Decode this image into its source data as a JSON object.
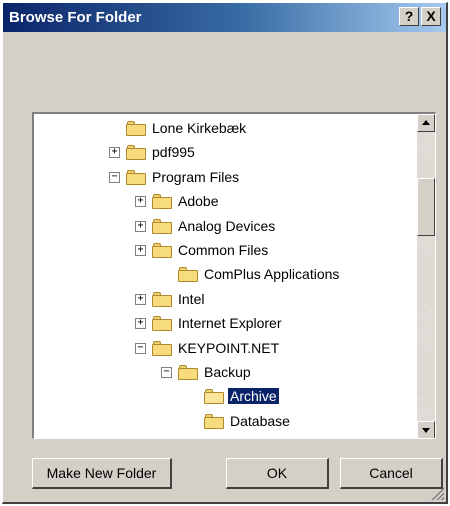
{
  "window": {
    "title": "Browse For Folder",
    "help_label": "?",
    "close_label": "X"
  },
  "tree": {
    "items": [
      {
        "label": "Lone Kirkebæk",
        "expander": "",
        "level": 2
      },
      {
        "label": "pdf995",
        "expander": "+",
        "level": 1
      },
      {
        "label": "Program Files",
        "expander": "−",
        "level": 1
      },
      {
        "label": "Adobe",
        "expander": "+",
        "level": 2
      },
      {
        "label": "Analog Devices",
        "expander": "+",
        "level": 2
      },
      {
        "label": "Common Files",
        "expander": "+",
        "level": 2
      },
      {
        "label": "ComPlus Applications",
        "expander": "",
        "level": 3
      },
      {
        "label": "Intel",
        "expander": "+",
        "level": 2
      },
      {
        "label": "Internet Explorer",
        "expander": "+",
        "level": 2
      },
      {
        "label": "KEYPOINT.NET",
        "expander": "−",
        "level": 2
      },
      {
        "label": "Backup",
        "expander": "−",
        "level": 3
      },
      {
        "label": "Archive",
        "expander": "",
        "level": 4,
        "selected": true
      },
      {
        "label": "Database",
        "expander": "",
        "level": 4
      }
    ]
  },
  "buttons": {
    "make_new_folder": "Make New Folder",
    "ok": "OK",
    "cancel": "Cancel"
  }
}
